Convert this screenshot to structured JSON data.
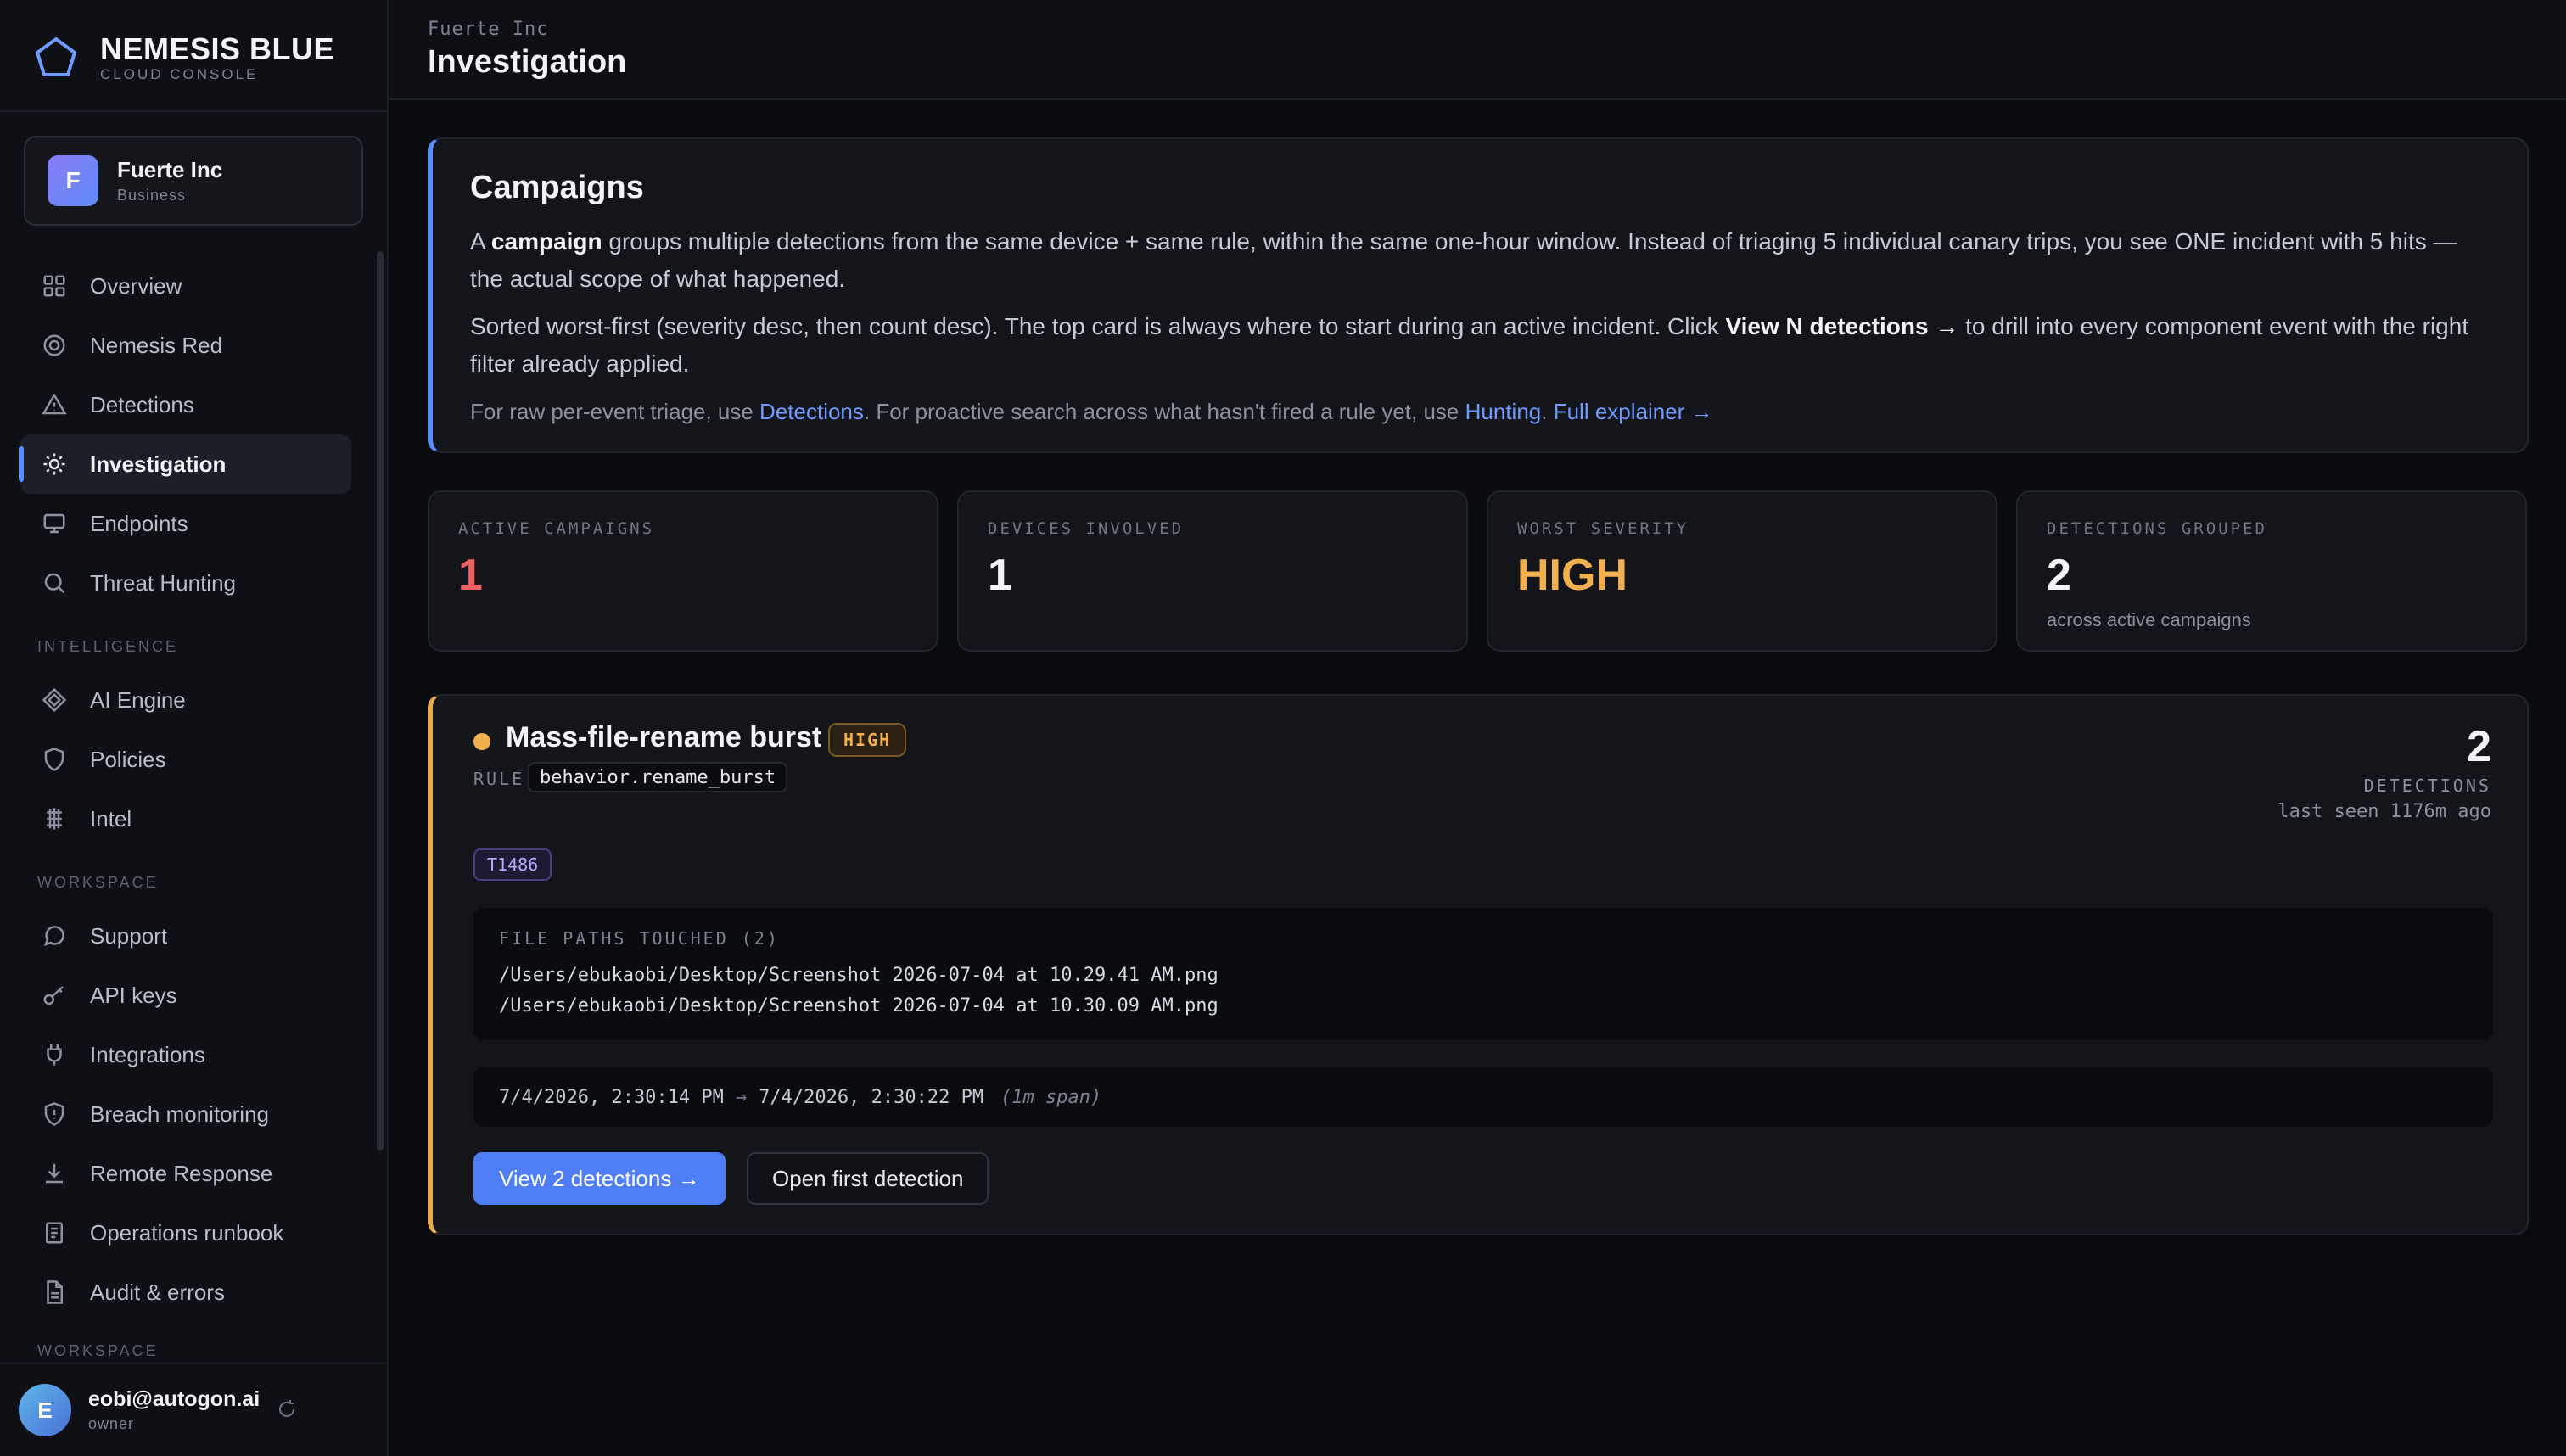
{
  "brand": {
    "name": "NEMESIS BLUE",
    "subtitle": "CLOUD CONSOLE",
    "logo_icon": "pentagon-icon"
  },
  "org": {
    "initial": "F",
    "name": "Fuerte Inc",
    "plan": "Business"
  },
  "nav": {
    "main": [
      {
        "label": "Overview",
        "icon": "grid-icon"
      },
      {
        "label": "Nemesis Red",
        "icon": "target-icon"
      },
      {
        "label": "Detections",
        "icon": "warning-icon"
      },
      {
        "label": "Investigation",
        "icon": "sun-icon",
        "active": true
      },
      {
        "label": "Endpoints",
        "icon": "monitor-icon"
      },
      {
        "label": "Threat Hunting",
        "icon": "search-icon"
      }
    ],
    "section_intelligence": "INTELLIGENCE",
    "intelligence": [
      {
        "label": "AI Engine",
        "icon": "diamond-icon"
      },
      {
        "label": "Policies",
        "icon": "shield-icon"
      },
      {
        "label": "Intel",
        "icon": "chip-icon"
      }
    ],
    "section_workspace": "WORKSPACE",
    "workspace": [
      {
        "label": "Support",
        "icon": "chat-icon"
      },
      {
        "label": "API keys",
        "icon": "key-icon"
      },
      {
        "label": "Integrations",
        "icon": "plug-icon"
      },
      {
        "label": "Breach monitoring",
        "icon": "shield-alert-icon"
      },
      {
        "label": "Remote Response",
        "icon": "download-icon"
      },
      {
        "label": "Operations runbook",
        "icon": "book-icon"
      },
      {
        "label": "Audit & errors",
        "icon": "file-icon"
      }
    ],
    "section_workspace_2": "WORKSPACE"
  },
  "user": {
    "initial": "E",
    "email": "eobi@autogon.ai",
    "role": "owner"
  },
  "header": {
    "breadcrumb": "Fuerte Inc",
    "title": "Investigation"
  },
  "explainer": {
    "title": "Campaigns",
    "p1_a": "A ",
    "p1_bold": "campaign",
    "p1_b": " groups multiple detections from the same device + same rule, within the same one-hour window. Instead of triaging 5 individual canary trips, you see ONE incident with 5 hits — the actual scope of what happened.",
    "p2_a": "Sorted worst-first (severity desc, then count desc). The top card is always where to start during an active incident. Click ",
    "p2_bold": "View N detections →",
    "p2_b": " to drill into every component event with the right filter already applied.",
    "foot_a": "For raw per-event triage, use ",
    "foot_link1": "Detections",
    "foot_b": ". For proactive search across what hasn't fired a rule yet, use ",
    "foot_link2": "Hunting",
    "foot_c": ". ",
    "foot_link3": "Full explainer →"
  },
  "stats": [
    {
      "label": "ACTIVE CAMPAIGNS",
      "value": "1",
      "color": "#f0605e"
    },
    {
      "label": "DEVICES INVOLVED",
      "value": "1",
      "color": "#f2f4f8"
    },
    {
      "label": "WORST SEVERITY",
      "value": "HIGH",
      "color": "#f0b04e"
    },
    {
      "label": "DETECTIONS GROUPED",
      "value": "2",
      "sub": "across active campaigns",
      "color": "#f2f4f8"
    }
  ],
  "campaign": {
    "title": "Mass-file-rename burst",
    "severity": "HIGH",
    "rule_label": "RULE",
    "rule": "behavior.rename_burst",
    "count": "2",
    "count_label": "DETECTIONS",
    "last_seen": "last seen 1176m ago",
    "tactic": "T1486",
    "paths_label": "FILE PATHS TOUCHED (2)",
    "paths": [
      "/Users/ebukaobi/Desktop/Screenshot 2026-07-04 at 10.29.41 AM.png",
      "/Users/ebukaobi/Desktop/Screenshot 2026-07-04 at 10.30.09 AM.png"
    ],
    "range_start": "7/4/2026, 2:30:14 PM",
    "range_arrow": "→",
    "range_end": "7/4/2026, 2:30:22 PM",
    "range_span": "(1m span)",
    "view_button": "View 2 detections →",
    "open_button": "Open first detection"
  }
}
